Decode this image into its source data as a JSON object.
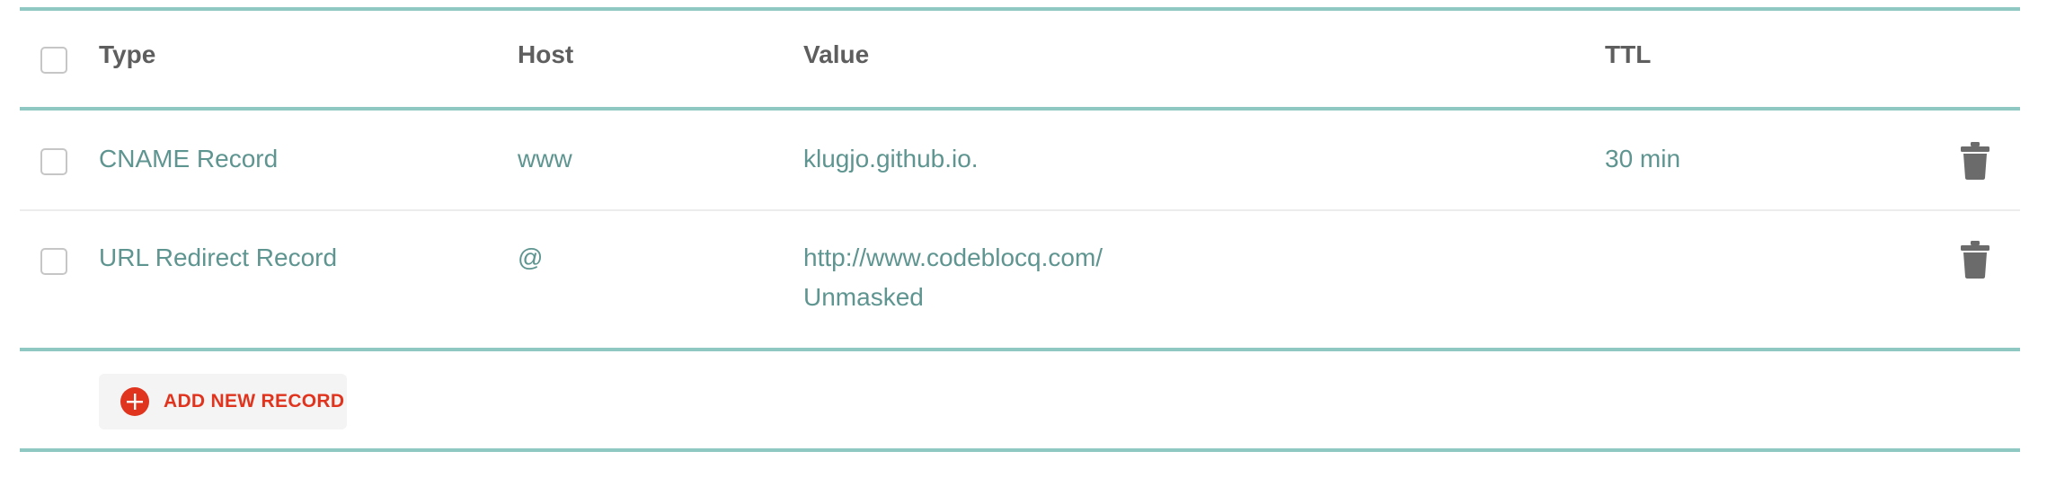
{
  "header": {
    "type": "Type",
    "host": "Host",
    "value": "Value",
    "ttl": "TTL"
  },
  "records": [
    {
      "type": "CNAME Record",
      "host": "www",
      "value": "klugjo.github.io.",
      "value_sub": "",
      "ttl": "30 min"
    },
    {
      "type": "URL Redirect Record",
      "host": "@",
      "value": "http://www.codeblocq.com/",
      "value_sub": "Unmasked",
      "ttl": ""
    }
  ],
  "actions": {
    "add_record_label": "ADD NEW RECORD",
    "add_icon": "plus-circle-icon",
    "delete_icon": "trash-icon"
  },
  "colors": {
    "accent_rule": "#8fc8c3",
    "record_text": "#5f9590",
    "header_text": "#5e5e5e",
    "add_red": "#e0341e",
    "trash": "#6b6b6b"
  }
}
